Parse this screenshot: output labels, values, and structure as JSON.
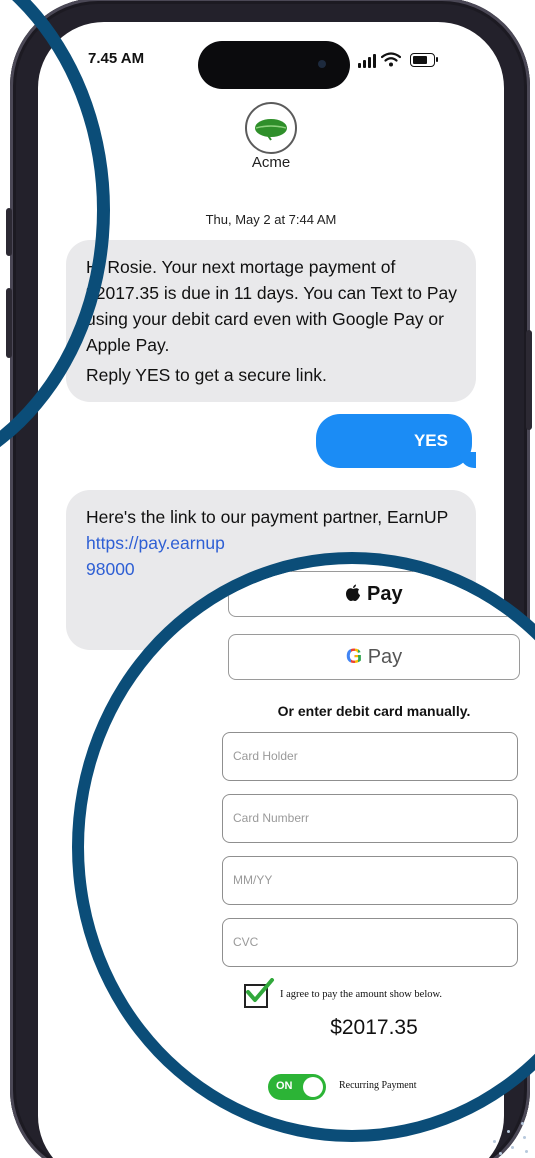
{
  "status_bar": {
    "time": "7.45 AM"
  },
  "contact": {
    "name": "Acme",
    "avatar_icon": "leaf-icon",
    "accent_color": "#2f8f2a"
  },
  "thread": {
    "timestamp": "Thu, May 2 at 7:44 AM",
    "incoming_1": {
      "line_1": "Hi Rosie. Your next mortage payment of $2017.35 is due in 11 days.  You can Text to Pay using your debit card even with Google Pay or Apple Pay.",
      "line_2": "Reply YES to get a secure link."
    },
    "outgoing_1": "YES",
    "incoming_2": {
      "text": "Here's the link to our payment partner, EarnUP",
      "link": "https://pay.earnup",
      "link_2": "98000"
    }
  },
  "payment_form": {
    "apple_pay_label": "Pay",
    "google_pay_g": "G",
    "google_pay_label": "Pay",
    "manual_label": "Or enter debit card manually.",
    "fields": {
      "card_holder": "Card Holder",
      "card_number": "Card Numberr",
      "expiry": "MM/YY",
      "cvc": "CVC"
    },
    "agree_label": "I agree to pay the amount show below.",
    "agree_checked": true,
    "amount": "$2017.35",
    "recurring_toggle": {
      "state": "ON",
      "label": "Recurring Payment"
    }
  },
  "colors": {
    "ring": "#0b4d78",
    "imessage_blue": "#1b8cf5",
    "incoming_gray": "#e9e9eb",
    "toggle_green": "#2cb436"
  }
}
